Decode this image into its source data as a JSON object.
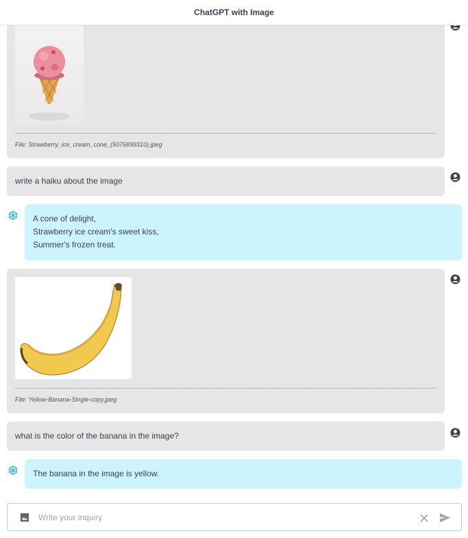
{
  "app": {
    "title": "ChatGPT with Image"
  },
  "messages": [
    {
      "role": "user",
      "type": "image",
      "image_subject": "strawberry ice cream cone",
      "file_label": "File: Strawberry_ice_cream_cone_(5076899310).jpeg"
    },
    {
      "role": "user",
      "type": "text",
      "text": "write a haiku about the image"
    },
    {
      "role": "assistant",
      "type": "text",
      "lines": [
        "A cone of delight,",
        "Strawberry ice cream's sweet kiss,",
        "Summer's frozen treat."
      ]
    },
    {
      "role": "user",
      "type": "image",
      "image_subject": "yellow banana",
      "file_label": "File: Yellow-Banana-Single-copy.jpeg"
    },
    {
      "role": "user",
      "type": "text",
      "text": "what is the color of the banana in the image?"
    },
    {
      "role": "assistant",
      "type": "text",
      "text": "The banana in the image is yellow."
    }
  ],
  "composer": {
    "placeholder": "Write your inquiry",
    "attach_icon": "image-icon",
    "clear_icon": "close-icon",
    "send_icon": "send-icon"
  },
  "colors": {
    "user_bubble": "#e6e6e6",
    "assistant_bubble": "#cbf4fc",
    "assistant_icon": "#2ab1c9",
    "user_icon": "#3f4650"
  }
}
